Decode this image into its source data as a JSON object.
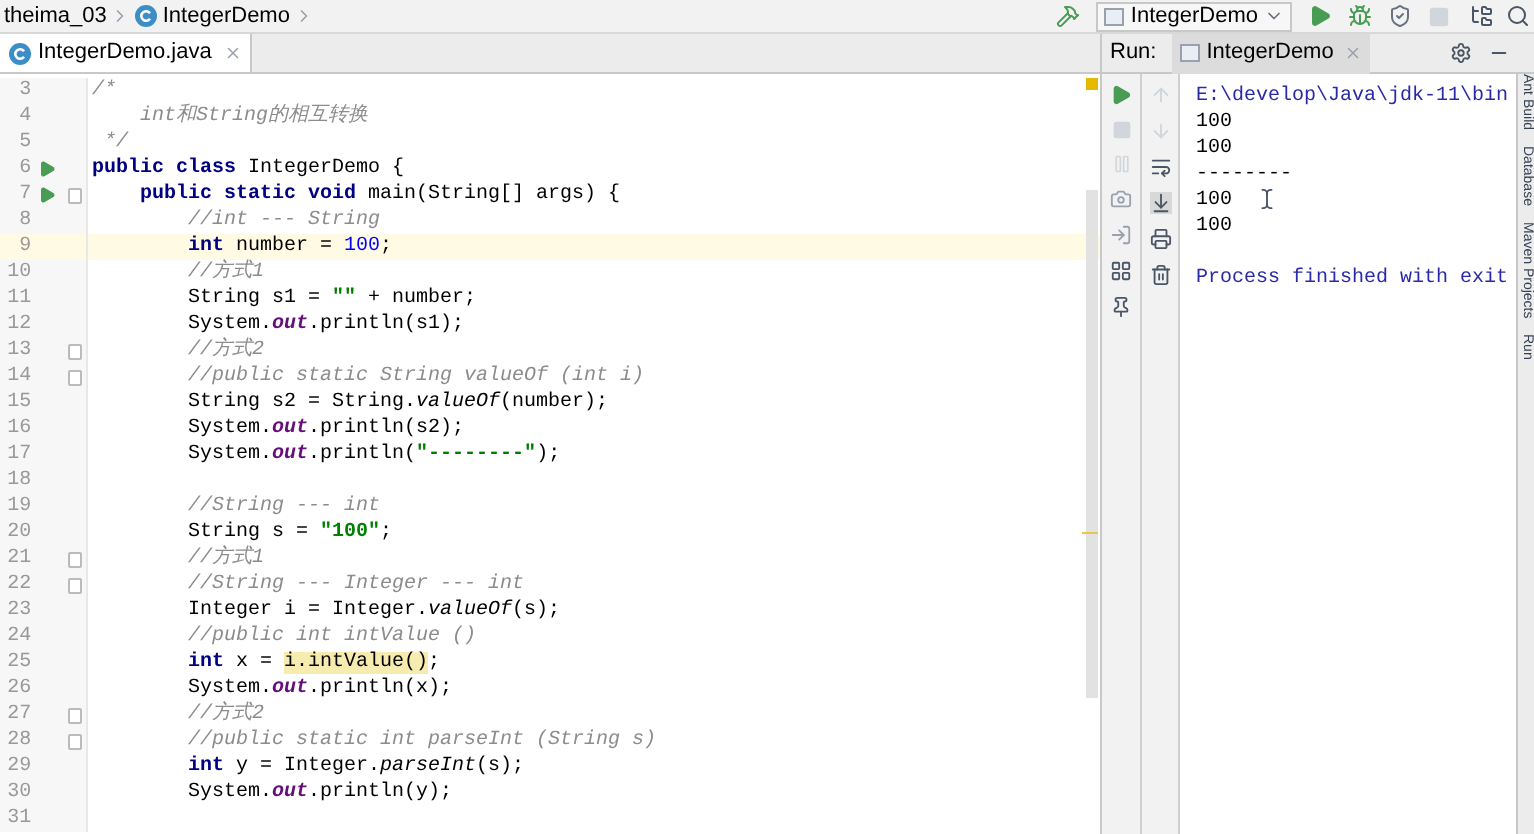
{
  "breadcrumb": [
    {
      "label": "theima_03",
      "icon": false
    },
    {
      "label": "IntegerDemo",
      "icon": true
    }
  ],
  "run_config": {
    "label": "IntegerDemo"
  },
  "editor_tab": {
    "label": "IntegerDemo.java",
    "selected": true
  },
  "code_lines": [
    {
      "number": "3",
      "current": false,
      "tokens": [
        {
          "text": "/*",
          "kind": "comment"
        }
      ]
    },
    {
      "number": "4",
      "current": false,
      "tokens": [
        {
          "text": "    int和String的相互转换",
          "kind": "comment"
        }
      ]
    },
    {
      "number": "5",
      "current": false,
      "tokens": [
        {
          "text": " */",
          "kind": "comment"
        }
      ]
    },
    {
      "number": "6",
      "current": false,
      "run_icon": true,
      "fold_icon": false,
      "tokens": [
        {
          "text": "public class",
          "kind": "keyword"
        },
        {
          "text": " IntegerDemo {",
          "kind": "plain"
        }
      ]
    },
    {
      "number": "7",
      "current": false,
      "run_icon": true,
      "fold_icon": true,
      "tokens": [
        {
          "text": "    public static void",
          "kind": "keyword"
        },
        {
          "text": " main(String[] args) {",
          "kind": "plain"
        }
      ]
    },
    {
      "number": "8",
      "current": false,
      "tokens": [
        {
          "text": "        //int --- String",
          "kind": "comment"
        }
      ]
    },
    {
      "number": "9",
      "current": true,
      "tokens": [
        {
          "text": "        int",
          "kind": "keyword"
        },
        {
          "text": " number = ",
          "kind": "plain"
        },
        {
          "text": "100",
          "kind": "number"
        },
        {
          "text": ";",
          "kind": "plain"
        }
      ]
    },
    {
      "number": "10",
      "current": false,
      "tokens": [
        {
          "text": "        //方式1",
          "kind": "comment"
        }
      ]
    },
    {
      "number": "11",
      "current": false,
      "tokens": [
        {
          "text": "        String s1 = ",
          "kind": "plain"
        },
        {
          "text": "\"\"",
          "kind": "string"
        },
        {
          "text": " + number;",
          "kind": "plain"
        }
      ]
    },
    {
      "number": "12",
      "current": false,
      "tokens": [
        {
          "text": "        System.",
          "kind": "plain"
        },
        {
          "text": "out",
          "kind": "field"
        },
        {
          "text": ".println(s1);",
          "kind": "plain"
        }
      ]
    },
    {
      "number": "13",
      "current": false,
      "run_icon": false,
      "fold_icon": true,
      "tokens": [
        {
          "text": "        //方式2",
          "kind": "comment"
        }
      ]
    },
    {
      "number": "14",
      "current": false,
      "run_icon": false,
      "fold_icon": true,
      "tokens": [
        {
          "text": "        //public static String valueOf (int i)",
          "kind": "comment"
        }
      ]
    },
    {
      "number": "15",
      "current": false,
      "tokens": [
        {
          "text": "        String s2 = String.",
          "kind": "plain"
        },
        {
          "text": "valueOf",
          "kind": "static"
        },
        {
          "text": "(number);",
          "kind": "plain"
        }
      ]
    },
    {
      "number": "16",
      "current": false,
      "tokens": [
        {
          "text": "        System.",
          "kind": "plain"
        },
        {
          "text": "out",
          "kind": "field"
        },
        {
          "text": ".println(s2);",
          "kind": "plain"
        }
      ]
    },
    {
      "number": "17",
      "current": false,
      "tokens": [
        {
          "text": "        System.",
          "kind": "plain"
        },
        {
          "text": "out",
          "kind": "field"
        },
        {
          "text": ".println(",
          "kind": "plain"
        },
        {
          "text": "\"--------\"",
          "kind": "string"
        },
        {
          "text": ");",
          "kind": "plain"
        }
      ]
    },
    {
      "number": "18",
      "current": false
    },
    {
      "number": "19",
      "current": false,
      "tokens": [
        {
          "text": "        //String --- int",
          "kind": "comment"
        }
      ]
    },
    {
      "number": "20",
      "current": false,
      "tokens": [
        {
          "text": "        String s = ",
          "kind": "plain"
        },
        {
          "text": "\"100\"",
          "kind": "string"
        },
        {
          "text": ";",
          "kind": "plain"
        }
      ]
    },
    {
      "number": "21",
      "current": false,
      "run_icon": false,
      "fold_icon": true,
      "tokens": [
        {
          "text": "        //方式1",
          "kind": "comment"
        }
      ]
    },
    {
      "number": "22",
      "current": false,
      "run_icon": false,
      "fold_icon": true,
      "tokens": [
        {
          "text": "        //String --- Integer --- int",
          "kind": "comment"
        }
      ]
    },
    {
      "number": "23",
      "current": false,
      "tokens": [
        {
          "text": "        Integer i = Integer.",
          "kind": "plain"
        },
        {
          "text": "valueOf",
          "kind": "static"
        },
        {
          "text": "(s);",
          "kind": "plain"
        }
      ]
    },
    {
      "number": "24",
      "current": false,
      "tokens": [
        {
          "text": "        //public int intValue ()",
          "kind": "comment"
        }
      ]
    },
    {
      "number": "25",
      "current": false,
      "tokens": [
        {
          "text": "        int",
          "kind": "keyword"
        },
        {
          "text": " x = ",
          "kind": "plain"
        },
        {
          "text": "i.intValue()",
          "kind": "match"
        },
        {
          "text": ";",
          "kind": "plain"
        }
      ]
    },
    {
      "number": "26",
      "current": false,
      "tokens": [
        {
          "text": "        System.",
          "kind": "plain"
        },
        {
          "text": "out",
          "kind": "field"
        },
        {
          "text": ".println(x);",
          "kind": "plain"
        }
      ]
    },
    {
      "number": "27",
      "current": false,
      "run_icon": false,
      "fold_icon": true,
      "tokens": [
        {
          "text": "        //方式2",
          "kind": "comment"
        }
      ]
    },
    {
      "number": "28",
      "current": false,
      "run_icon": false,
      "fold_icon": true,
      "tokens": [
        {
          "text": "        //public static int parseInt (String s)",
          "kind": "comment"
        }
      ]
    },
    {
      "number": "29",
      "current": false,
      "tokens": [
        {
          "text": "        int",
          "kind": "keyword"
        },
        {
          "text": " y = Integer.",
          "kind": "plain"
        },
        {
          "text": "parseInt",
          "kind": "static"
        },
        {
          "text": "(s);",
          "kind": "plain"
        }
      ]
    },
    {
      "number": "30",
      "current": false,
      "tokens": [
        {
          "text": "        System.",
          "kind": "plain"
        },
        {
          "text": "out",
          "kind": "field"
        },
        {
          "text": ".println(y);",
          "kind": "plain"
        }
      ]
    },
    {
      "number": "31",
      "current": false
    }
  ],
  "run_panel": {
    "title": "Run:",
    "tab": {
      "label": "IntegerDemo",
      "selected": true
    },
    "console": [
      {
        "text": "E:\\develop\\Java\\jdk-11\\bin",
        "kind": "command"
      },
      {
        "text": "100",
        "kind": "output"
      },
      {
        "text": "100",
        "kind": "output"
      },
      {
        "text": "--------",
        "kind": "output"
      },
      {
        "text": "100",
        "kind": "output"
      },
      {
        "text": "100",
        "kind": "output"
      },
      {
        "text": "Process finished with exit",
        "kind": "message"
      }
    ]
  },
  "side_stripe": [
    "Ant Build",
    "Database",
    "Maven Projects",
    "Run"
  ]
}
